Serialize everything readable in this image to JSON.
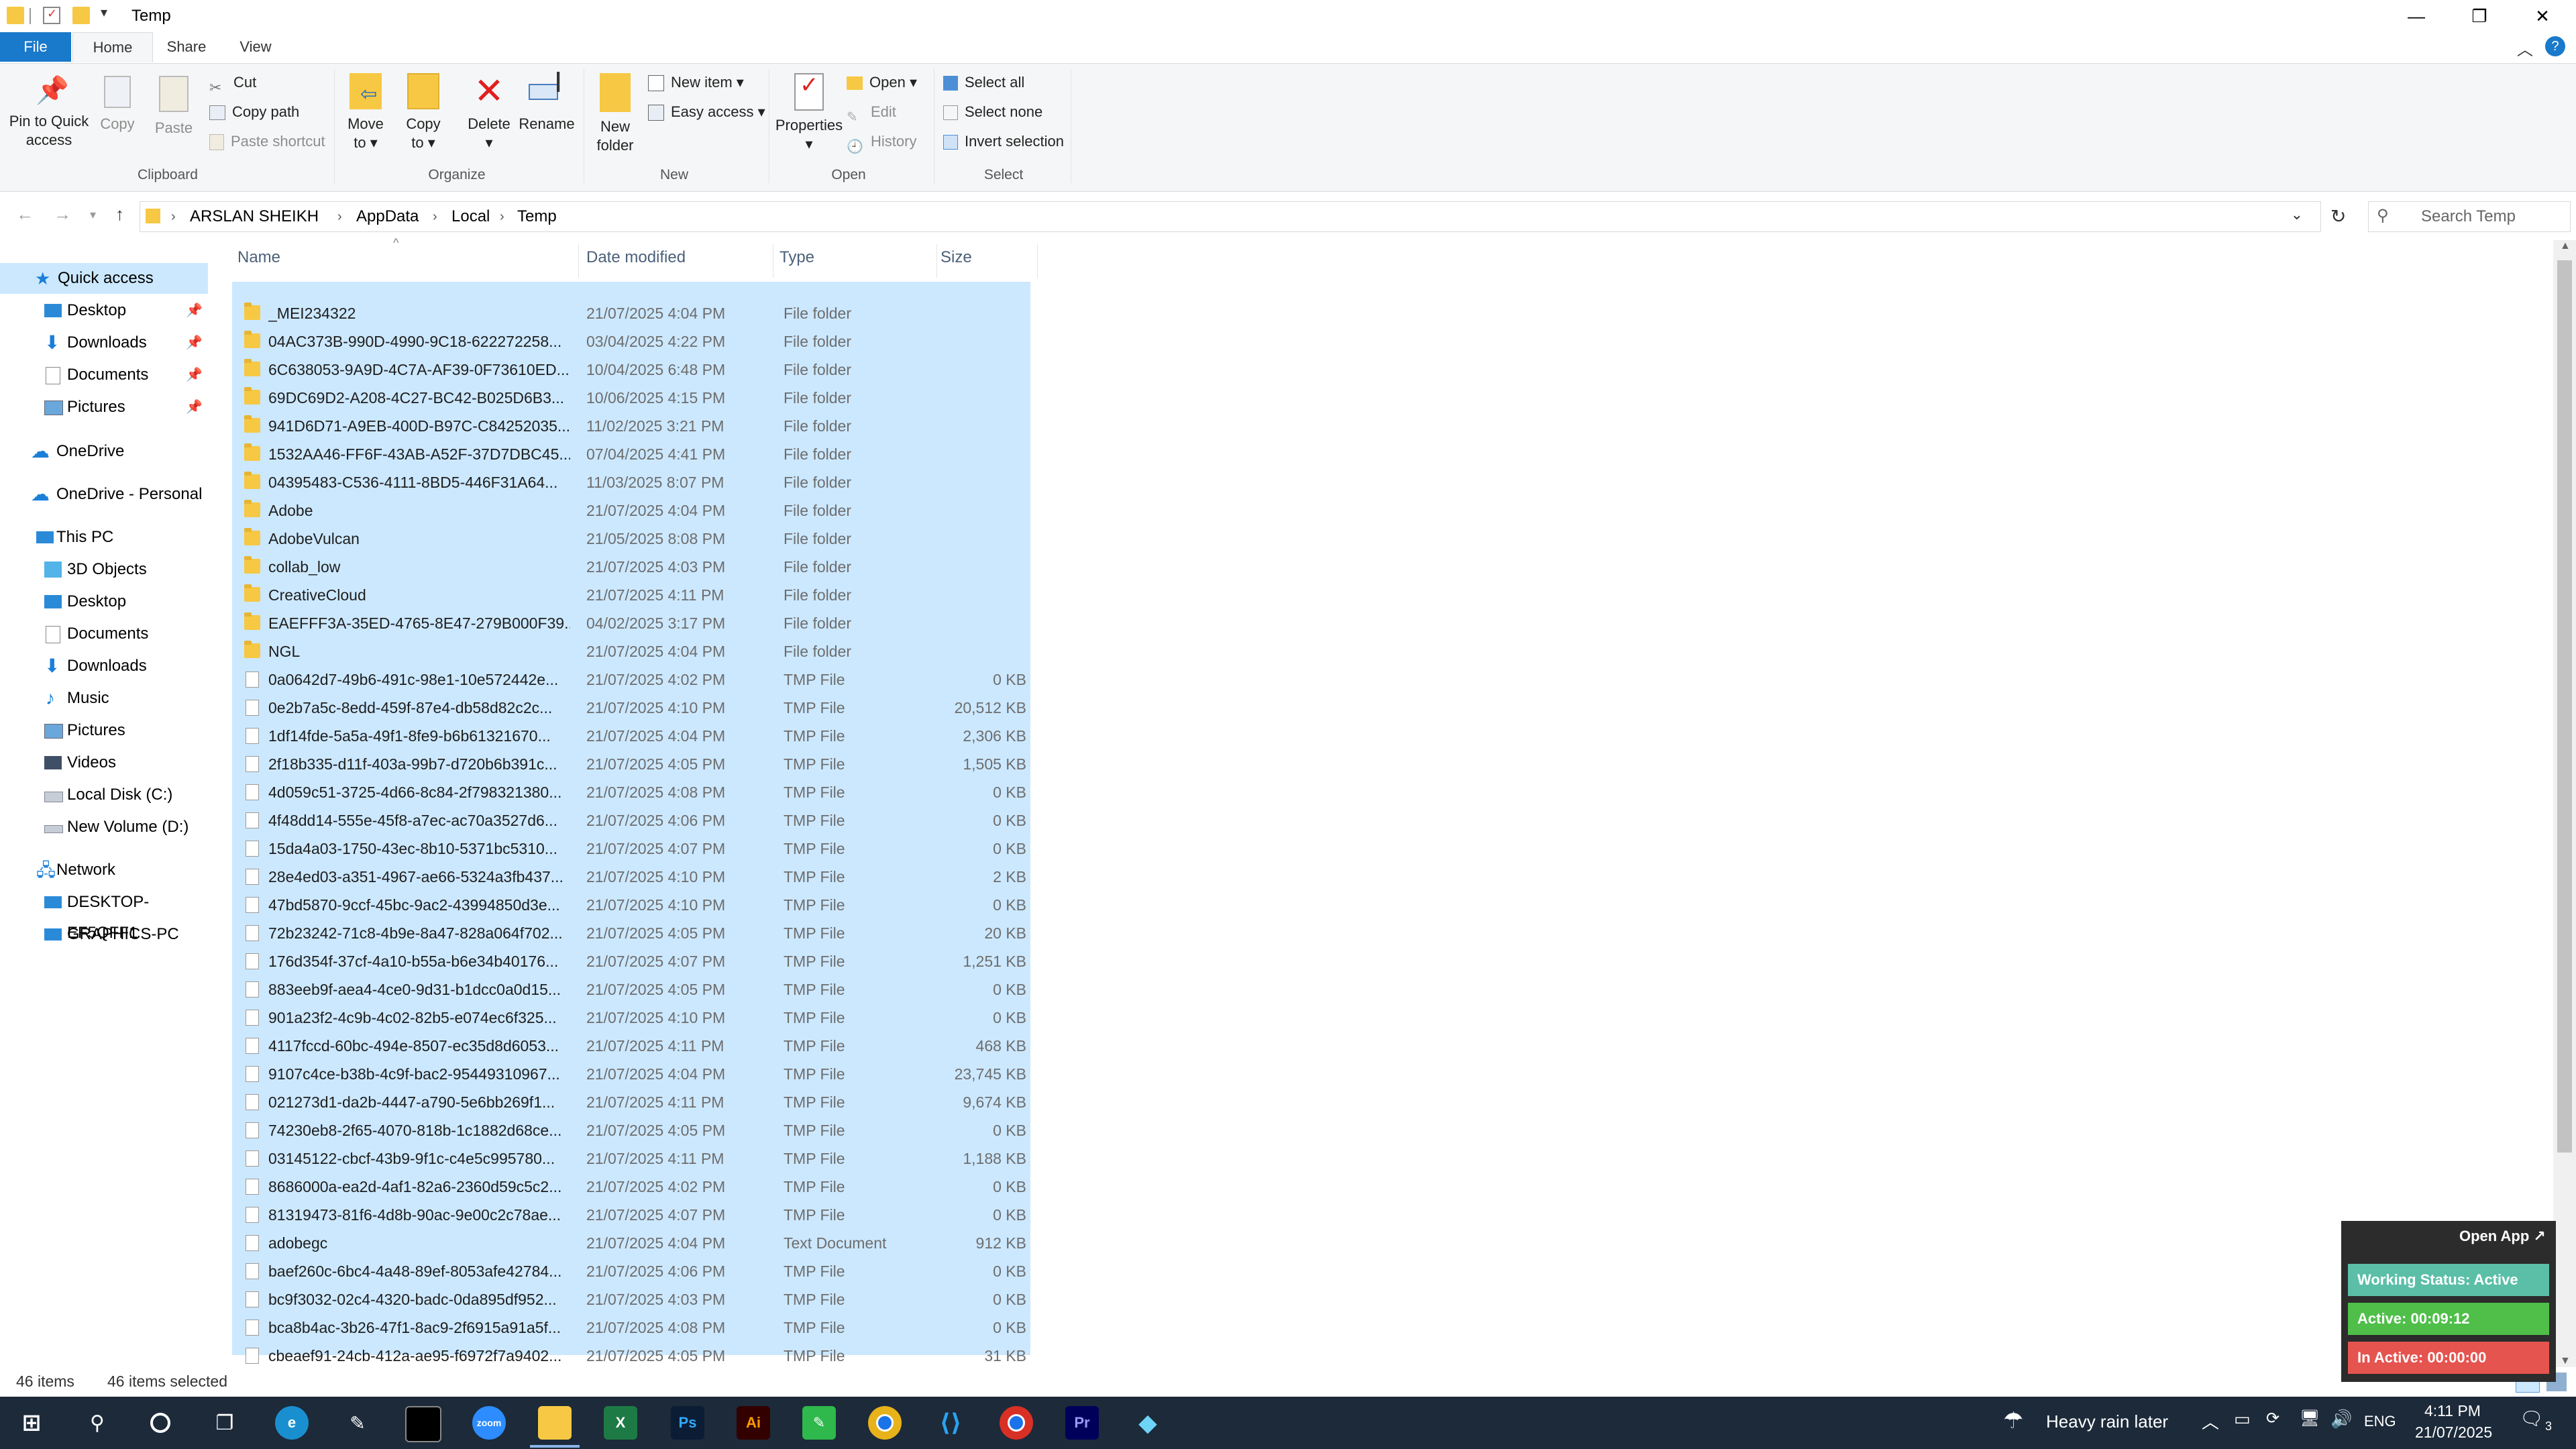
{
  "window": {
    "title": "Temp"
  },
  "ribbon_tabs": [
    "File",
    "Home",
    "Share",
    "View"
  ],
  "ribbon": {
    "clipboard": {
      "label": "Clipboard",
      "pin_line1": "Pin to Quick",
      "pin_line2": "access",
      "copy": "Copy",
      "paste": "Paste",
      "cut": "Cut",
      "copy_path": "Copy path",
      "paste_shortcut": "Paste shortcut"
    },
    "organize": {
      "label": "Organize",
      "move_line1": "Move",
      "move_line2": "to",
      "copy_line1": "Copy",
      "copy_line2": "to",
      "delete": "Delete",
      "rename": "Rename"
    },
    "new": {
      "label": "New",
      "folder_line1": "New",
      "folder_line2": "folder",
      "new_item": "New item",
      "easy_access": "Easy access"
    },
    "open": {
      "label": "Open",
      "properties": "Properties",
      "open": "Open",
      "edit": "Edit",
      "history": "History"
    },
    "select": {
      "label": "Select",
      "select_all": "Select all",
      "select_none": "Select none",
      "invert": "Invert selection"
    }
  },
  "address": {
    "crumbs": [
      "ARSLAN SHEIKH",
      "AppData",
      "Local",
      "Temp"
    ],
    "search_placeholder": "Search Temp"
  },
  "nav": {
    "quick_access": "Quick access",
    "qa_items": [
      "Desktop",
      "Downloads",
      "Documents",
      "Pictures"
    ],
    "onedrive": "OneDrive",
    "onedrive_personal": "OneDrive - Personal",
    "this_pc": "This PC",
    "pc_items": [
      "3D Objects",
      "Desktop",
      "Documents",
      "Downloads",
      "Music",
      "Pictures",
      "Videos",
      "Local Disk (C:)",
      "New Volume (D:)"
    ],
    "network": "Network",
    "network_items": [
      "DESKTOP-EF5QFF1",
      "GRAPHICS-PC"
    ]
  },
  "columns": {
    "name": "Name",
    "date": "Date modified",
    "type": "Type",
    "size": "Size"
  },
  "files": [
    {
      "name": "_MEI234322",
      "date": "21/07/2025 4:04 PM",
      "type": "File folder",
      "size": "",
      "kind": "folder"
    },
    {
      "name": "04AC373B-990D-4990-9C18-622272258...",
      "date": "03/04/2025 4:22 PM",
      "type": "File folder",
      "size": "",
      "kind": "folder"
    },
    {
      "name": "6C638053-9A9D-4C7A-AF39-0F73610ED...",
      "date": "10/04/2025 6:48 PM",
      "type": "File folder",
      "size": "",
      "kind": "folder"
    },
    {
      "name": "69DC69D2-A208-4C27-BC42-B025D6B3...",
      "date": "10/06/2025 4:15 PM",
      "type": "File folder",
      "size": "",
      "kind": "folder"
    },
    {
      "name": "941D6D71-A9EB-400D-B97C-C84252035...",
      "date": "11/02/2025 3:21 PM",
      "type": "File folder",
      "size": "",
      "kind": "folder"
    },
    {
      "name": "1532AA46-FF6F-43AB-A52F-37D7DBC45...",
      "date": "07/04/2025 4:41 PM",
      "type": "File folder",
      "size": "",
      "kind": "folder"
    },
    {
      "name": "04395483-C536-4111-8BD5-446F31A64...",
      "date": "11/03/2025 8:07 PM",
      "type": "File folder",
      "size": "",
      "kind": "folder"
    },
    {
      "name": "Adobe",
      "date": "21/07/2025 4:04 PM",
      "type": "File folder",
      "size": "",
      "kind": "folder"
    },
    {
      "name": "AdobeVulcan",
      "date": "21/05/2025 8:08 PM",
      "type": "File folder",
      "size": "",
      "kind": "folder"
    },
    {
      "name": "collab_low",
      "date": "21/07/2025 4:03 PM",
      "type": "File folder",
      "size": "",
      "kind": "folder"
    },
    {
      "name": "CreativeCloud",
      "date": "21/07/2025 4:11 PM",
      "type": "File folder",
      "size": "",
      "kind": "folder"
    },
    {
      "name": "EAEFFF3A-35ED-4765-8E47-279B000F39...",
      "date": "04/02/2025 3:17 PM",
      "type": "File folder",
      "size": "",
      "kind": "folder"
    },
    {
      "name": "NGL",
      "date": "21/07/2025 4:04 PM",
      "type": "File folder",
      "size": "",
      "kind": "folder"
    },
    {
      "name": "0a0642d7-49b6-491c-98e1-10e572442e...",
      "date": "21/07/2025 4:02 PM",
      "type": "TMP File",
      "size": "0 KB",
      "kind": "file"
    },
    {
      "name": "0e2b7a5c-8edd-459f-87e4-db58d82c2c...",
      "date": "21/07/2025 4:10 PM",
      "type": "TMP File",
      "size": "20,512 KB",
      "kind": "file"
    },
    {
      "name": "1df14fde-5a5a-49f1-8fe9-b6b61321670...",
      "date": "21/07/2025 4:04 PM",
      "type": "TMP File",
      "size": "2,306 KB",
      "kind": "file"
    },
    {
      "name": "2f18b335-d11f-403a-99b7-d720b6b391c...",
      "date": "21/07/2025 4:05 PM",
      "type": "TMP File",
      "size": "1,505 KB",
      "kind": "file"
    },
    {
      "name": "4d059c51-3725-4d66-8c84-2f798321380...",
      "date": "21/07/2025 4:08 PM",
      "type": "TMP File",
      "size": "0 KB",
      "kind": "file"
    },
    {
      "name": "4f48dd14-555e-45f8-a7ec-ac70a3527d6...",
      "date": "21/07/2025 4:06 PM",
      "type": "TMP File",
      "size": "0 KB",
      "kind": "file"
    },
    {
      "name": "15da4a03-1750-43ec-8b10-5371bc5310...",
      "date": "21/07/2025 4:07 PM",
      "type": "TMP File",
      "size": "0 KB",
      "kind": "file"
    },
    {
      "name": "28e4ed03-a351-4967-ae66-5324a3fb437...",
      "date": "21/07/2025 4:10 PM",
      "type": "TMP File",
      "size": "2 KB",
      "kind": "file"
    },
    {
      "name": "47bd5870-9ccf-45bc-9ac2-43994850d3e...",
      "date": "21/07/2025 4:10 PM",
      "type": "TMP File",
      "size": "0 KB",
      "kind": "file"
    },
    {
      "name": "72b23242-71c8-4b9e-8a47-828a064f702...",
      "date": "21/07/2025 4:05 PM",
      "type": "TMP File",
      "size": "20 KB",
      "kind": "file"
    },
    {
      "name": "176d354f-37cf-4a10-b55a-b6e34b40176...",
      "date": "21/07/2025 4:07 PM",
      "type": "TMP File",
      "size": "1,251 KB",
      "kind": "file"
    },
    {
      "name": "883eeb9f-aea4-4ce0-9d31-b1dcc0a0d15...",
      "date": "21/07/2025 4:05 PM",
      "type": "TMP File",
      "size": "0 KB",
      "kind": "file"
    },
    {
      "name": "901a23f2-4c9b-4c02-82b5-e074ec6f325...",
      "date": "21/07/2025 4:10 PM",
      "type": "TMP File",
      "size": "0 KB",
      "kind": "file"
    },
    {
      "name": "4117fccd-60bc-494e-8507-ec35d8d6053...",
      "date": "21/07/2025 4:11 PM",
      "type": "TMP File",
      "size": "468 KB",
      "kind": "file"
    },
    {
      "name": "9107c4ce-b38b-4c9f-bac2-95449310967...",
      "date": "21/07/2025 4:04 PM",
      "type": "TMP File",
      "size": "23,745 KB",
      "kind": "file"
    },
    {
      "name": "021273d1-da2b-4447-a790-5e6bb269f1...",
      "date": "21/07/2025 4:11 PM",
      "type": "TMP File",
      "size": "9,674 KB",
      "kind": "file"
    },
    {
      "name": "74230eb8-2f65-4070-818b-1c1882d68ce...",
      "date": "21/07/2025 4:05 PM",
      "type": "TMP File",
      "size": "0 KB",
      "kind": "file"
    },
    {
      "name": "03145122-cbcf-43b9-9f1c-c4e5c995780...",
      "date": "21/07/2025 4:11 PM",
      "type": "TMP File",
      "size": "1,188 KB",
      "kind": "file"
    },
    {
      "name": "8686000a-ea2d-4af1-82a6-2360d59c5c2...",
      "date": "21/07/2025 4:02 PM",
      "type": "TMP File",
      "size": "0 KB",
      "kind": "file"
    },
    {
      "name": "81319473-81f6-4d8b-90ac-9e00c2c78ae...",
      "date": "21/07/2025 4:07 PM",
      "type": "TMP File",
      "size": "0 KB",
      "kind": "file"
    },
    {
      "name": "adobegc",
      "date": "21/07/2025 4:04 PM",
      "type": "Text Document",
      "size": "912 KB",
      "kind": "file"
    },
    {
      "name": "baef260c-6bc4-4a48-89ef-8053afe42784...",
      "date": "21/07/2025 4:06 PM",
      "type": "TMP File",
      "size": "0 KB",
      "kind": "file"
    },
    {
      "name": "bc9f3032-02c4-4320-badc-0da895df952...",
      "date": "21/07/2025 4:03 PM",
      "type": "TMP File",
      "size": "0 KB",
      "kind": "file"
    },
    {
      "name": "bca8b4ac-3b26-47f1-8ac9-2f6915a91a5f...",
      "date": "21/07/2025 4:08 PM",
      "type": "TMP File",
      "size": "0 KB",
      "kind": "file"
    },
    {
      "name": "cbeaef91-24cb-412a-ae95-f6972f7a9402...",
      "date": "21/07/2025 4:05 PM",
      "type": "TMP File",
      "size": "31 KB",
      "kind": "file"
    }
  ],
  "status": {
    "items": "46 items",
    "selected": "46 items selected"
  },
  "widget": {
    "open_app": "Open App ↗",
    "working": "Working Status: Active",
    "active": "Active: 00:09:12",
    "inactive": "In Active: 00:00:00",
    "colors": {
      "working": "#5bbfa8",
      "active": "#4fbf4a",
      "inactive": "#e5544f"
    }
  },
  "taskbar": {
    "weather": "Heavy rain later",
    "lang": "ENG",
    "time": "4:11 PM",
    "date": "21/07/2025",
    "notifications": "3",
    "apps": [
      "start-icon",
      "search-icon",
      "cortana-icon",
      "task-view-icon",
      "edge-icon",
      "pen-icon",
      "terminal-icon",
      "zoom-icon",
      "file-explorer-icon",
      "excel-icon",
      "photoshop-icon",
      "illustrator-icon",
      "green-app-icon",
      "chrome-icon",
      "vscode-icon",
      "chrome-profile-icon",
      "premiere-icon",
      "blue-app-icon"
    ]
  },
  "colors": {
    "selection": "#cce8ff",
    "file_tab": "#1979ca",
    "taskbar": "#1c2a3a"
  }
}
